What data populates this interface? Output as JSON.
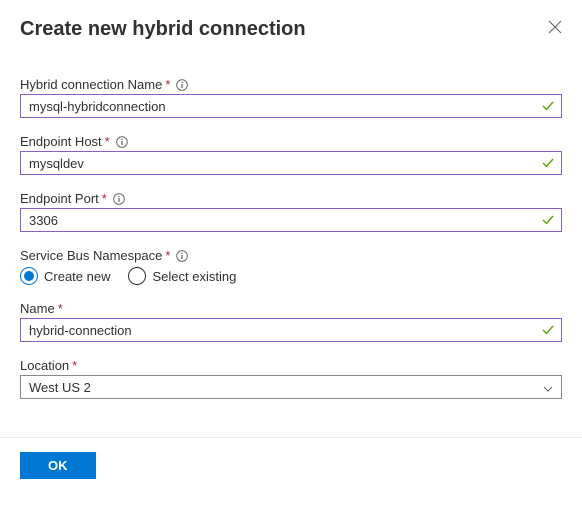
{
  "panel": {
    "title": "Create new hybrid connection",
    "fields": {
      "connName": {
        "label": "Hybrid connection Name",
        "value": "mysql-hybridconnection"
      },
      "host": {
        "label": "Endpoint Host",
        "value": "mysqldev"
      },
      "port": {
        "label": "Endpoint Port",
        "value": "3306"
      },
      "sbns": {
        "label": "Service Bus Namespace",
        "options": {
          "create": "Create new",
          "existing": "Select existing"
        },
        "selected": "create"
      },
      "name": {
        "label": "Name",
        "value": "hybrid-connection"
      },
      "location": {
        "label": "Location",
        "value": "West US 2"
      }
    },
    "footer": {
      "ok": "OK"
    }
  }
}
